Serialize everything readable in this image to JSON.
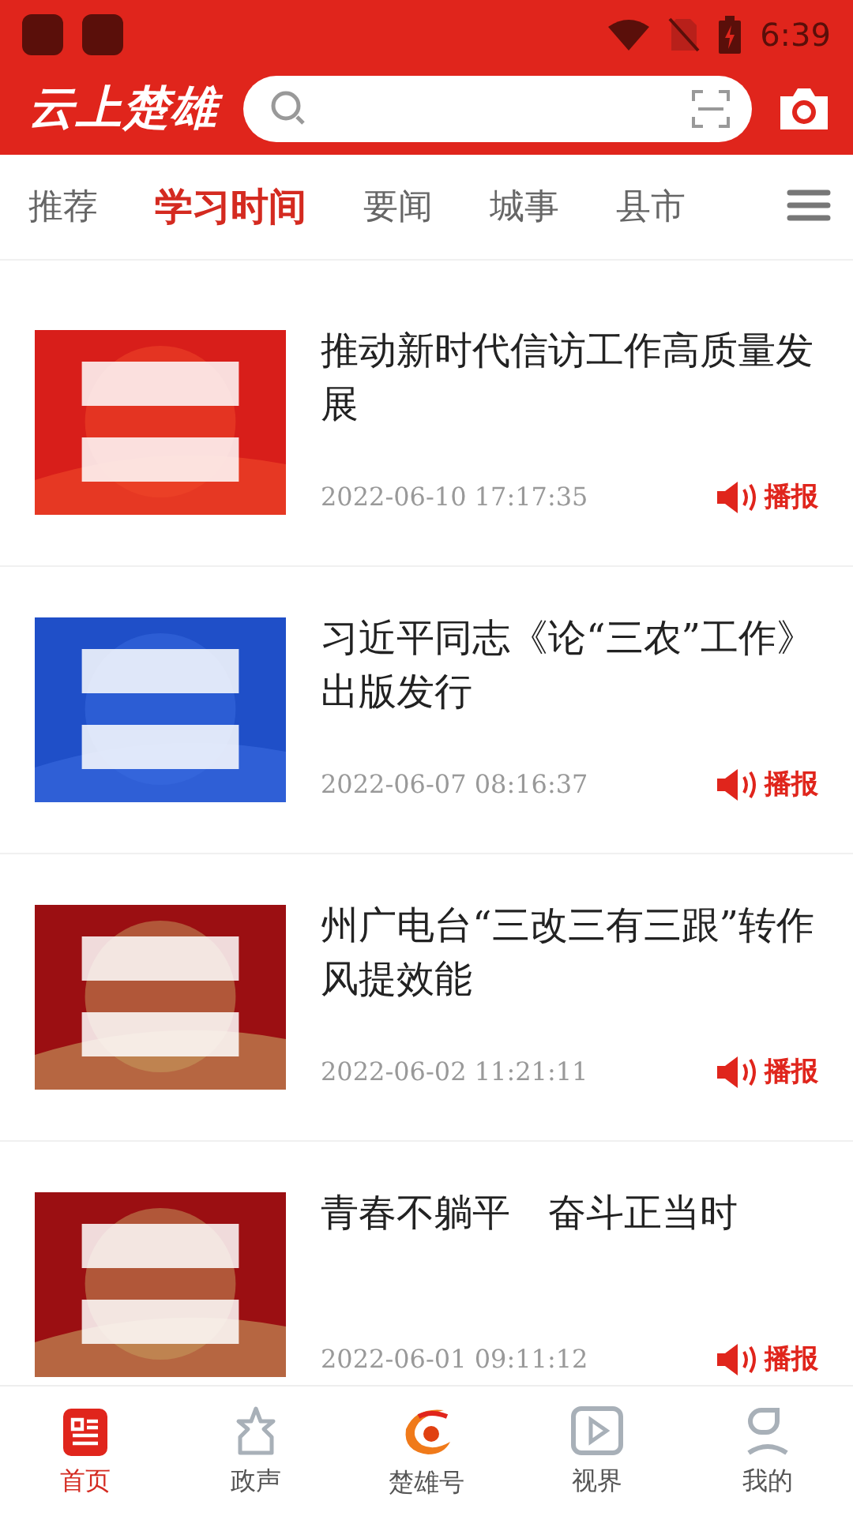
{
  "status_bar": {
    "time": "6:39"
  },
  "header": {
    "logo": "云上楚雄"
  },
  "tabs": [
    {
      "label": "推荐",
      "selected": false
    },
    {
      "label": "学习时间",
      "selected": true
    },
    {
      "label": "要闻",
      "selected": false
    },
    {
      "label": "城事",
      "selected": false
    },
    {
      "label": "县市",
      "selected": false
    }
  ],
  "articles": [
    {
      "title": "推动新时代信访工作高质量发展",
      "time": "2022-06-10 17:17:35",
      "action": "播报"
    },
    {
      "title": "习近平同志《论“三农”工作》出版发行",
      "time": "2022-06-07 08:16:37",
      "action": "播报"
    },
    {
      "title": "州广电台“三改三有三跟”转作风提效能",
      "time": "2022-06-02 11:21:11",
      "action": "播报"
    },
    {
      "title": "青春不躺平　奋斗正当时",
      "time": "2022-06-01 09:11:12",
      "action": "播报"
    }
  ],
  "bottom_nav": [
    {
      "label": "首页",
      "selected": true
    },
    {
      "label": "政声",
      "selected": false
    },
    {
      "label": "楚雄号",
      "selected": false
    },
    {
      "label": "视界",
      "selected": false
    },
    {
      "label": "我的",
      "selected": false
    }
  ]
}
